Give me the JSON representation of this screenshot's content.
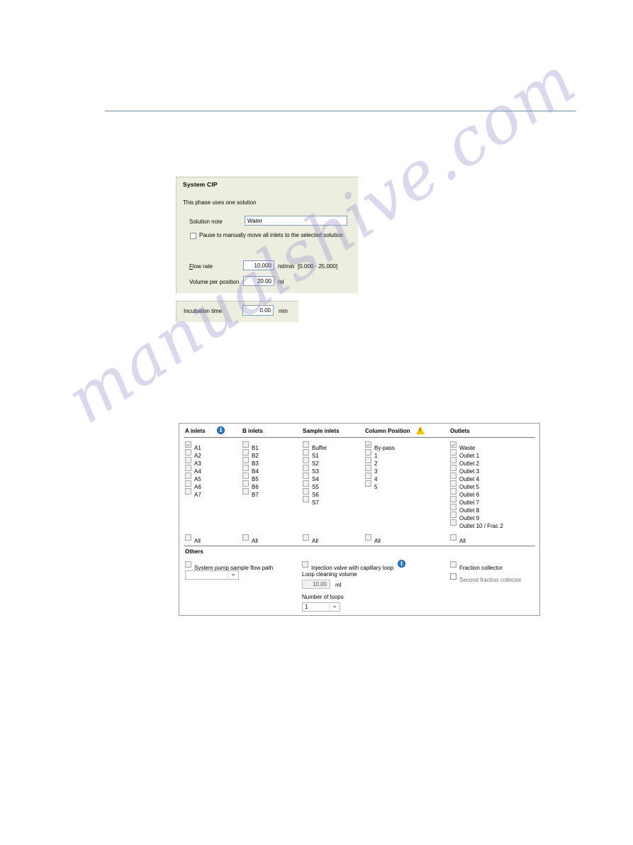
{
  "watermark": {
    "text": "manualshive.com"
  },
  "system_cip": {
    "title": "System CIP",
    "subtitle": "This phase uses one solution",
    "solution_note_label": "Solution note",
    "solution_note_value": "Water",
    "pause_checkbox_label": "Pause to manually move all inlets to the selected solution",
    "flow_rate_label": "Flow rate",
    "flow_rate_value": "10.000",
    "flow_rate_unit": "ml/min",
    "flow_rate_range": "[0.000 - 25.000]",
    "volume_label": "Volume per position",
    "volume_value": "20.00",
    "volume_unit": "ml"
  },
  "incubation": {
    "label": "Incubation time",
    "value": "0.00",
    "unit": "min"
  },
  "flow_path": {
    "all_label": "All",
    "columns": [
      {
        "header": "A inlets",
        "icon": "info-icon",
        "items": [
          {
            "label": "A1",
            "checked": true
          },
          {
            "label": "A2",
            "checked": false
          },
          {
            "label": "A3",
            "checked": false
          },
          {
            "label": "A4",
            "checked": false
          },
          {
            "label": "A5",
            "checked": false
          },
          {
            "label": "A6",
            "checked": false
          },
          {
            "label": "A7",
            "checked": false
          }
        ]
      },
      {
        "header": "B inlets",
        "icon": null,
        "items": [
          {
            "label": "B1",
            "checked": false
          },
          {
            "label": "B2",
            "checked": false
          },
          {
            "label": "B3",
            "checked": false
          },
          {
            "label": "B4",
            "checked": false
          },
          {
            "label": "B5",
            "checked": false
          },
          {
            "label": "B6",
            "checked": false
          },
          {
            "label": "B7",
            "checked": false
          }
        ]
      },
      {
        "header": "Sample inlets",
        "icon": null,
        "items": [
          {
            "label": "Buffer",
            "checked": false
          },
          {
            "label": "S1",
            "checked": false
          },
          {
            "label": "S2",
            "checked": false
          },
          {
            "label": "S3",
            "checked": false
          },
          {
            "label": "S4",
            "checked": false
          },
          {
            "label": "S5",
            "checked": false
          },
          {
            "label": "S6",
            "checked": false
          },
          {
            "label": "S7",
            "checked": false
          }
        ]
      },
      {
        "header": "Column Position",
        "icon": "warning-icon",
        "items": [
          {
            "label": "By-pass",
            "checked": true
          },
          {
            "label": "1",
            "checked": false
          },
          {
            "label": "2",
            "checked": false
          },
          {
            "label": "3",
            "checked": false
          },
          {
            "label": "4",
            "checked": false
          },
          {
            "label": "5",
            "checked": false
          }
        ]
      },
      {
        "header": "Outlets",
        "icon": null,
        "items": [
          {
            "label": "Waste",
            "checked": true
          },
          {
            "label": "Outlet 1",
            "checked": false
          },
          {
            "label": "Outlet 2",
            "checked": false
          },
          {
            "label": "Outlet 3",
            "checked": false
          },
          {
            "label": "Outlet 4",
            "checked": false
          },
          {
            "label": "Outlet 5",
            "checked": false
          },
          {
            "label": "Outlet 6",
            "checked": false
          },
          {
            "label": "Outlet 7",
            "checked": false
          },
          {
            "label": "Outlet 8",
            "checked": false
          },
          {
            "label": "Outlet 9",
            "checked": false
          },
          {
            "label": "Outlet 10 / Frac 2",
            "checked": false
          }
        ]
      }
    ]
  },
  "others": {
    "title": "Others",
    "system_pump_label": "System pump sample flow path",
    "system_pump_select_value": "",
    "injection_valve_label": "Injection valve with capillary loop",
    "injection_valve_icon": "info-icon",
    "loop_cleaning_label": "Loop cleaning volume",
    "loop_cleaning_value": "10.00",
    "loop_cleaning_unit": "ml",
    "number_of_loops_label": "Number of loops",
    "number_of_loops_value": "1",
    "fraction_collector_label": "Fraction collector",
    "second_fraction_collector_label": "Second fraction collector"
  }
}
